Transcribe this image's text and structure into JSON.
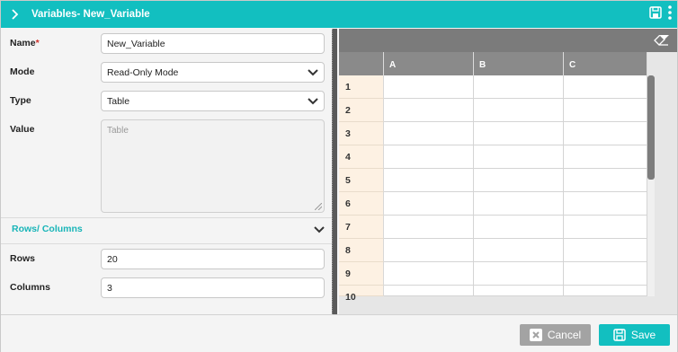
{
  "header": {
    "title": "Variables- New_Variable",
    "icons": [
      "chevron-right-icon",
      "save-icon",
      "kebab-menu-icon"
    ]
  },
  "form": {
    "name": {
      "label": "Name",
      "required_mark": "*",
      "value": "New_Variable"
    },
    "mode": {
      "label": "Mode",
      "value": "Read-Only Mode"
    },
    "type": {
      "label": "Type",
      "value": "Table"
    },
    "value": {
      "label": "Value",
      "placeholder": "Table"
    },
    "section_title": "Rows/ Columns",
    "rows": {
      "label": "Rows",
      "value": "20"
    },
    "columns": {
      "label": "Columns",
      "value": "3"
    }
  },
  "sheet": {
    "columns": [
      "A",
      "B",
      "C"
    ],
    "row_numbers": [
      "1",
      "2",
      "3",
      "4",
      "5",
      "6",
      "7",
      "8",
      "9",
      "10"
    ]
  },
  "footer": {
    "cancel_label": "Cancel",
    "save_label": "Save"
  },
  "colors": {
    "accent": "#12bfc0",
    "row_header_bg": "#fdf1e3",
    "column_header_bg": "#8a8a8a"
  }
}
